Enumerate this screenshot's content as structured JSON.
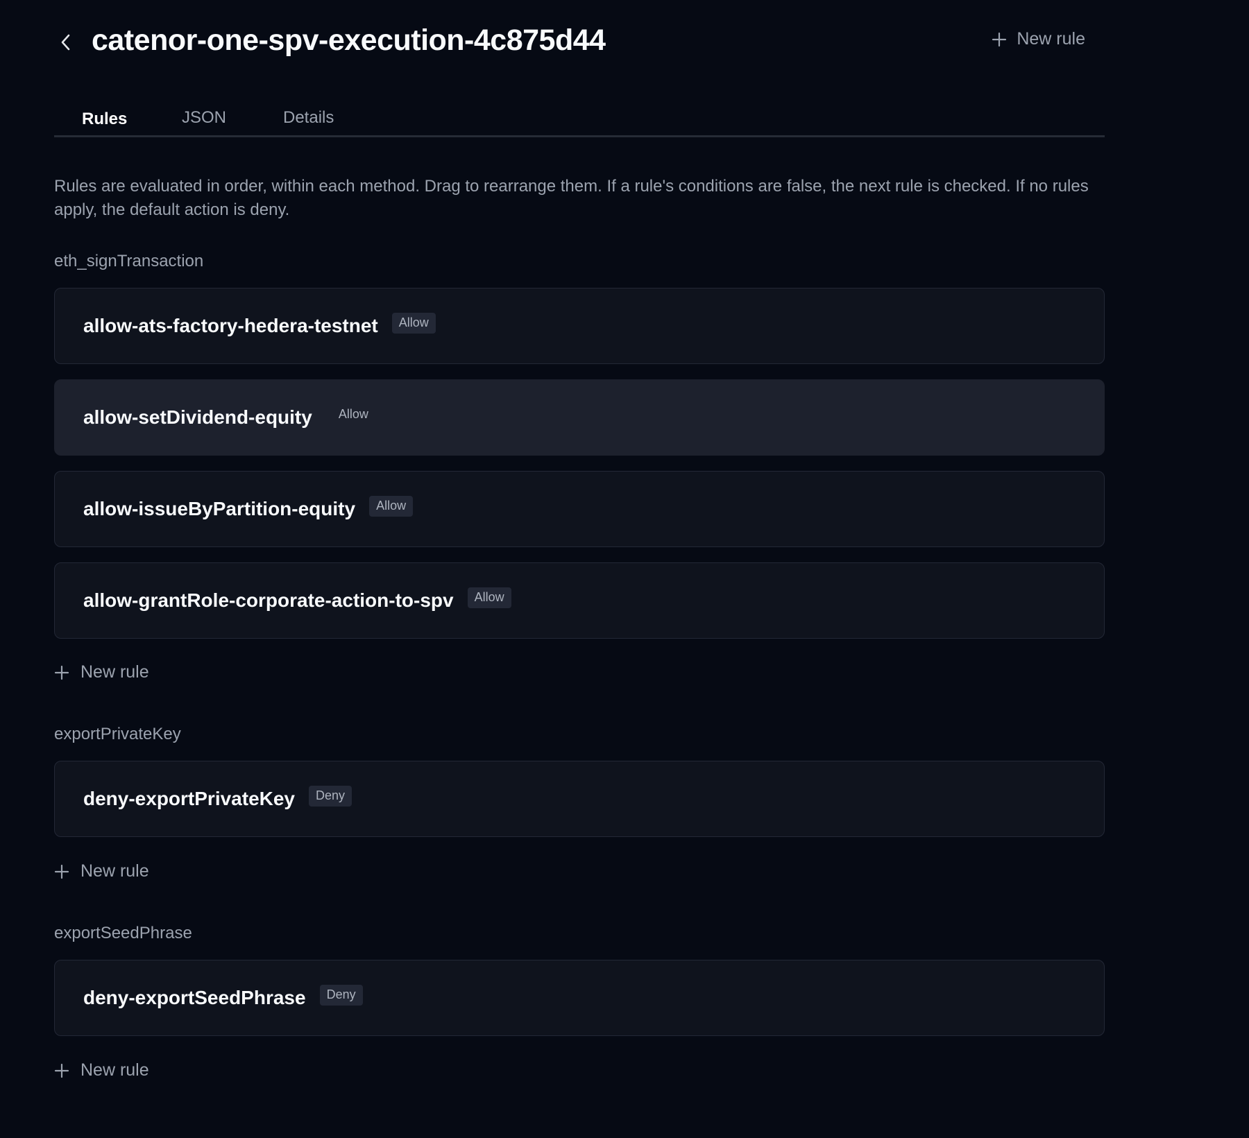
{
  "header": {
    "title": "catenor-one-spv-execution-4c875d44",
    "new_rule_label": "New rule"
  },
  "tabs": [
    {
      "label": "Rules",
      "active": true
    },
    {
      "label": "JSON",
      "active": false
    },
    {
      "label": "Details",
      "active": false
    }
  ],
  "description": "Rules are evaluated in order, within each method. Drag to rearrange them. If a rule's conditions are false, the next rule is checked. If no rules apply, the default action is deny.",
  "sections": [
    {
      "method": "eth_signTransaction",
      "rules": [
        {
          "name": "allow-ats-factory-hedera-testnet",
          "action": "Allow"
        },
        {
          "name": "allow-setDividend-equity",
          "action": "Allow"
        },
        {
          "name": "allow-issueByPartition-equity",
          "action": "Allow"
        },
        {
          "name": "allow-grantRole-corporate-action-to-spv",
          "action": "Allow"
        }
      ],
      "add_label": "New rule"
    },
    {
      "method": "exportPrivateKey",
      "rules": [
        {
          "name": "deny-exportPrivateKey",
          "action": "Deny"
        }
      ],
      "add_label": "New rule"
    },
    {
      "method": "exportSeedPhrase",
      "rules": [
        {
          "name": "deny-exportSeedPhrase",
          "action": "Deny"
        }
      ],
      "add_label": "New rule"
    }
  ],
  "colors": {
    "background": "#060a14",
    "card": "#0f131d",
    "card_hover": "#1d212d",
    "muted_text": "#9ca3af",
    "primary_text": "#f8fafc"
  },
  "icons": {
    "back": "chevron-left-icon",
    "add": "plus-icon"
  }
}
